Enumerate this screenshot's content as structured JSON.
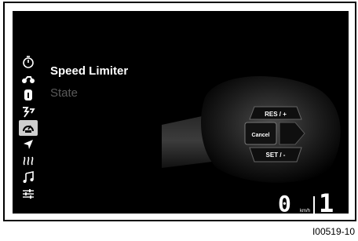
{
  "menu": {
    "title": "Speed Limiter",
    "subtitle": "State"
  },
  "sidebar": {
    "items": [
      {
        "icon": "stopwatch-icon"
      },
      {
        "icon": "motorcycle-icon"
      },
      {
        "icon": "info-icon"
      },
      {
        "icon": "riding-mode-icon"
      },
      {
        "icon": "speed-limiter-icon",
        "selected": true
      },
      {
        "icon": "navigation-icon"
      },
      {
        "icon": "heated-grip-icon"
      },
      {
        "icon": "music-icon"
      },
      {
        "icon": "settings-sliders-icon"
      }
    ]
  },
  "controls": {
    "res_label": "RES / +",
    "cancel_label": "Cancel",
    "set_label": "SET / -"
  },
  "status": {
    "speed": "0",
    "speed_unit": "km/h",
    "gear": "1"
  },
  "figure_code": "I00519-10",
  "colors": {
    "screen_bg": "#000000",
    "text_primary": "#ffffff",
    "text_muted": "#5a5a5a",
    "selected_bg": "#cfcfcf"
  }
}
